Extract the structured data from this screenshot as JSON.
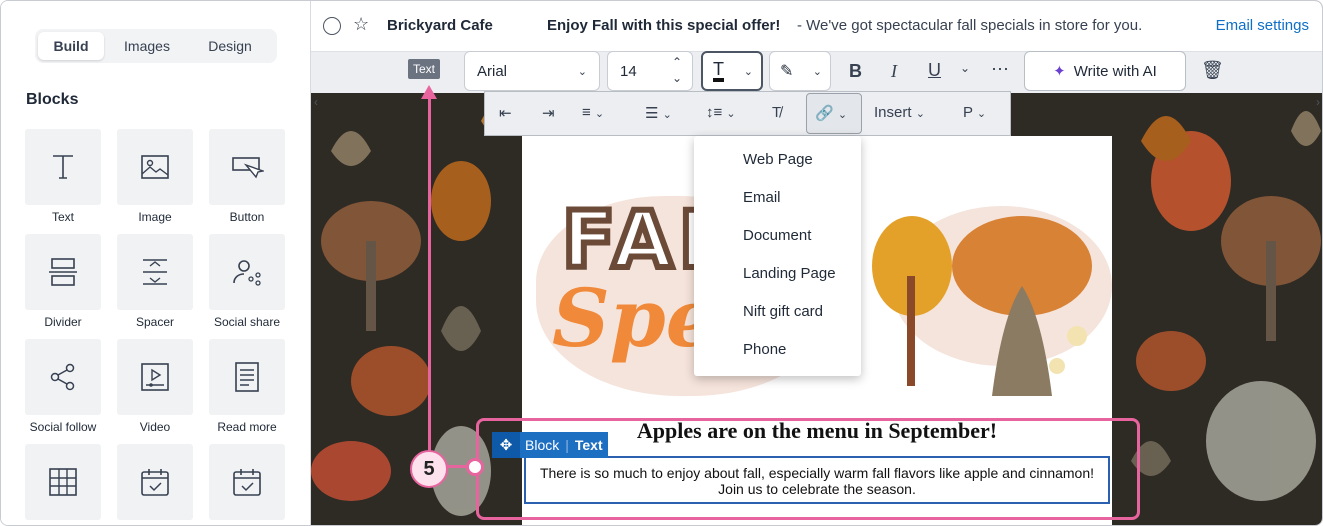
{
  "sidebar": {
    "tabs": [
      "Build",
      "Images",
      "Design"
    ],
    "active_tab": "Build",
    "blocks_title": "Blocks",
    "blocks": [
      {
        "label": "Text",
        "icon": "text-icon"
      },
      {
        "label": "Image",
        "icon": "image-icon"
      },
      {
        "label": "Button",
        "icon": "button-icon"
      },
      {
        "label": "Divider",
        "icon": "divider-icon"
      },
      {
        "label": "Spacer",
        "icon": "spacer-icon"
      },
      {
        "label": "Social share",
        "icon": "social-share-icon"
      },
      {
        "label": "Social follow",
        "icon": "social-follow-icon"
      },
      {
        "label": "Video",
        "icon": "video-icon"
      },
      {
        "label": "Read more",
        "icon": "read-more-icon"
      },
      {
        "label": "",
        "icon": "table-icon"
      },
      {
        "label": "",
        "icon": "calendar-icon"
      },
      {
        "label": "",
        "icon": "event-icon"
      }
    ]
  },
  "header": {
    "sender": "Brickyard Cafe",
    "subject": "Enjoy Fall with this special offer!",
    "preheader": "- We've got spectacular fall specials in store for you.",
    "settings_link": "Email settings"
  },
  "toolbar": {
    "context_chip": "Text",
    "font_family": "Arial",
    "font_size": "14",
    "ai_button": "Write with AI",
    "insert_label": "Insert",
    "paragraph_label": "P"
  },
  "link_menu": {
    "items": [
      "Web Page",
      "Email",
      "Document",
      "Landing Page",
      "Nift gift card",
      "Phone"
    ]
  },
  "email": {
    "hero_word1": "FAL",
    "hero_word2": "Spec",
    "headline": "Apples are on the menu in September!",
    "body": "There is so much to enjoy about fall, especially warm fall flavors like apple and cinnamon! Join us to celebrate the season.",
    "badge_block": "Block",
    "badge_text": "Text"
  },
  "annotation": {
    "step_number": "5",
    "color": "#e8649e"
  },
  "colors": {
    "accent": "#0e6fc8",
    "background_pattern": "#2e2a24",
    "selection_border": "#2b5fb0"
  }
}
